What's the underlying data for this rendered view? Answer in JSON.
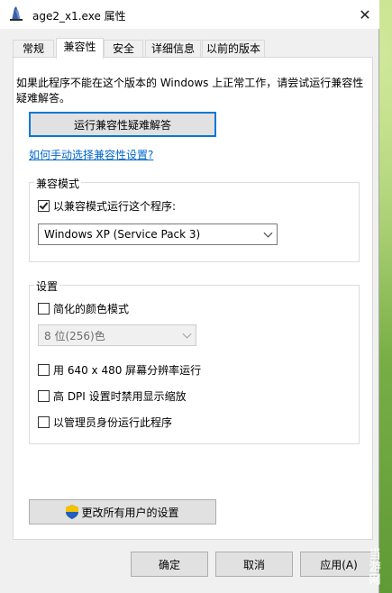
{
  "window": {
    "title": "age2_x1.exe 属性",
    "close_glyph": "✕"
  },
  "tabs": [
    {
      "label": "常规"
    },
    {
      "label": "兼容性"
    },
    {
      "label": "安全"
    },
    {
      "label": "详细信息"
    },
    {
      "label": "以前的版本"
    }
  ],
  "active_tab": "兼容性",
  "intro_text": "如果此程序不能在这个版本的 Windows 上正常工作，请尝试运行兼容性疑难解答。",
  "troubleshoot_button": "运行兼容性疑难解答",
  "manual_link": "如何手动选择兼容性设置?",
  "compat_mode": {
    "title": "兼容模式",
    "checkbox_label": "以兼容模式运行这个程序:",
    "checked": true,
    "selected_os": "Windows XP (Service Pack 3)"
  },
  "settings": {
    "title": "设置",
    "reduced_color_label": "简化的颜色模式",
    "color_depth": "8 位(256)色",
    "resolution_label": "用 640 x 480 屏幕分辨率运行",
    "dpi_label": "高 DPI 设置时禁用显示缩放",
    "admin_label": "以管理员身份运行此程序"
  },
  "all_users_button": "更改所有用户的设置",
  "footer": {
    "ok": "确定",
    "cancel": "取消",
    "apply": "应用(A)"
  },
  "watermark": "当游网",
  "colors": {
    "accent": "#0078d7",
    "link": "#0066cc"
  },
  "icons": {
    "app": "aoe-app-icon",
    "shield": "uac-shield-icon"
  }
}
